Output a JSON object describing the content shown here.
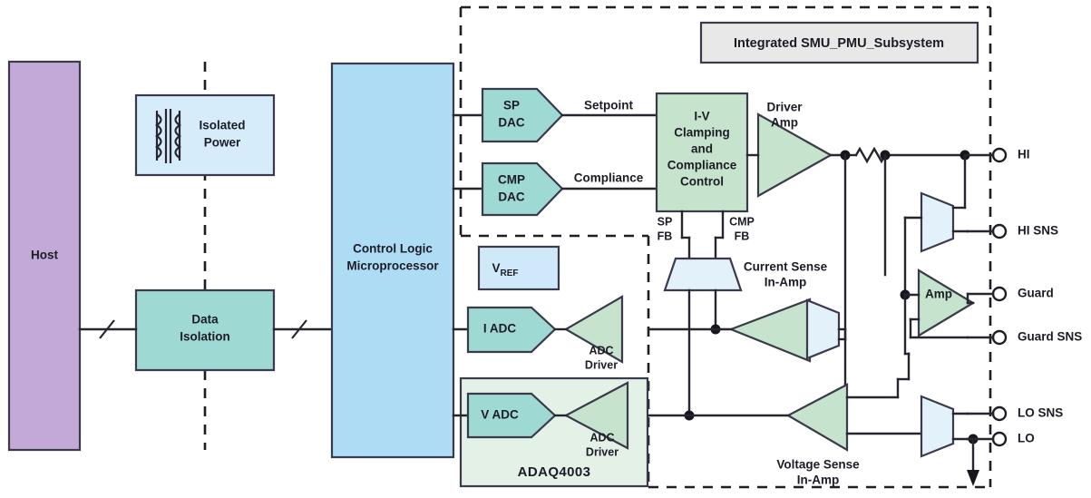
{
  "diagram": {
    "title": "Integrated SMU_PMU_Subsystem",
    "colors": {
      "host_fill": "#c3a9d8",
      "light_blue_fill": "#aedcf5",
      "pale_blue_fill": "#cfe9fb",
      "teal_fill": "#9fd9d3",
      "green_fill": "#c6e3cd",
      "pale_green_fill": "#e4f1e7",
      "mux_fill": "#e3f1fb",
      "title_fill": "#e8e8e8",
      "stroke": "#3a3a4a",
      "wire": "#262630"
    }
  },
  "blocks": {
    "host": "Host",
    "isolated_power": "Isolated\nPower",
    "isolated_power_line1": "Isolated",
    "isolated_power_line2": "Power",
    "data_isolation_line1": "Data",
    "data_isolation_line2": "Isolation",
    "control_logic_line1": "Control Logic",
    "control_logic_line2": "Microprocessor",
    "sp_dac_line1": "SP",
    "sp_dac_line2": "DAC",
    "cmp_dac_line1": "CMP",
    "cmp_dac_line2": "DAC",
    "vref_main": "V",
    "vref_sub": "REF",
    "i_adc": "I ADC",
    "v_adc": "V ADC",
    "adc_driver_line1": "ADC",
    "adc_driver_line2": "Driver",
    "adaq_part": "ADAQ4003",
    "iv_clamp_line1": "I-V",
    "iv_clamp_line2": "Clamping",
    "iv_clamp_line3": "and",
    "iv_clamp_line4": "Compliance",
    "iv_clamp_line5": "Control",
    "driver_amp_line1": "Driver",
    "driver_amp_line2": "Amp",
    "guard_amp": "Amp",
    "current_sense_line1": "Current Sense",
    "current_sense_line2": "In-Amp",
    "voltage_sense_line1": "Voltage Sense",
    "voltage_sense_line2": "In-Amp"
  },
  "signals": {
    "setpoint": "Setpoint",
    "compliance": "Compliance",
    "sp_fb_line1": "SP",
    "sp_fb_line2": "FB",
    "cmp_fb_line1": "CMP",
    "cmp_fb_line2": "FB"
  },
  "terminals": [
    {
      "label": "HI"
    },
    {
      "label": "HI SNS"
    },
    {
      "label": "Guard"
    },
    {
      "label": "Guard SNS"
    },
    {
      "label": "LO SNS"
    },
    {
      "label": "LO"
    }
  ]
}
